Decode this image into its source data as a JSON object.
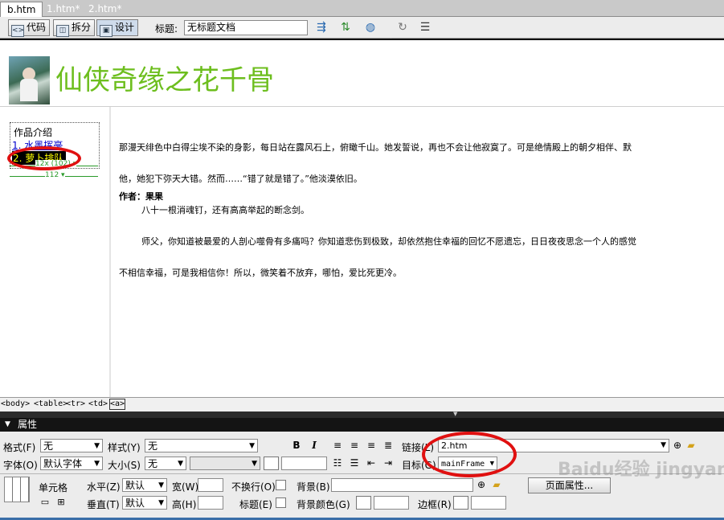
{
  "tabs": [
    "b.htm",
    "1.htm*",
    "2.htm*"
  ],
  "toolbar": {
    "code_label": "代码",
    "split_label": "拆分",
    "design_label": "设计",
    "title_label": "标题:",
    "title_value": "无标题文档"
  },
  "page": {
    "heading": "仙侠奇缘之花千骨",
    "left_frame": {
      "items": [
        "作品介绍",
        "1. 水墨挥毫",
        "2. 萝卜排队"
      ],
      "width_ruler": "12x (102) ▾",
      "width_ruler_bottom": "112 ▾"
    },
    "body_lines": [
      "那漫天绯色中白得尘埃不染的身影，每日站在露风石上，俯瞰千山。她发誓说，再也不会让他寂寞了。可是绝情殿上的朝夕相伴、默",
      "他，她犯下弥天大错。然而……“错了就是错了。”他淡漠依旧。",
      "        八十一根消魂钉，还有高高举起的断念剑。",
      "        师父，你知道被最爱的人剖心噬骨有多痛吗？你知道悲伤到极致，却依然抱住幸福的回忆不愿遗忘，日日夜夜思念一个人的感觉",
      "不相信幸福，可是我相信你！所以，微笑着不放弃，哪怕，爱比死更冷。"
    ],
    "author": "作者：果果"
  },
  "tagbar": [
    "<body>",
    "<table>",
    "<tr>",
    "<td>",
    "<a>"
  ],
  "properties": {
    "header": "属性",
    "format_label": "格式(F)",
    "format_value": "无",
    "style_label": "样式(Y)",
    "style_value": "无",
    "font_label": "字体(O)",
    "font_value": "默认字体",
    "size_label": "大小(S)",
    "size_value": "无",
    "link_label": "链接(L)",
    "link_value": "2.htm",
    "target_label": "目标(G)",
    "target_value": "mainFrame",
    "cell_label": "单元格",
    "horz_label": "水平(Z)",
    "horz_value": "默认",
    "vert_label": "垂直(T)",
    "vert_value": "默认",
    "width_label": "宽(W)",
    "height_label": "高(H)",
    "nowrap_label": "不换行(O)",
    "header_label": "标题(E)",
    "bg_label": "背景(B)",
    "bgcolor_label": "背景颜色(G)",
    "border_label": "边框(R)",
    "page_props_button": "页面属性..."
  },
  "watermark": "Baidu经验 jingyan.baidu.com",
  "colors": {
    "heading_green": "#6dbe1e",
    "annotation_red": "#e01010",
    "selection_bg": "#000000",
    "selection_text": "#ffff00",
    "link_blue": "#0000cc"
  }
}
